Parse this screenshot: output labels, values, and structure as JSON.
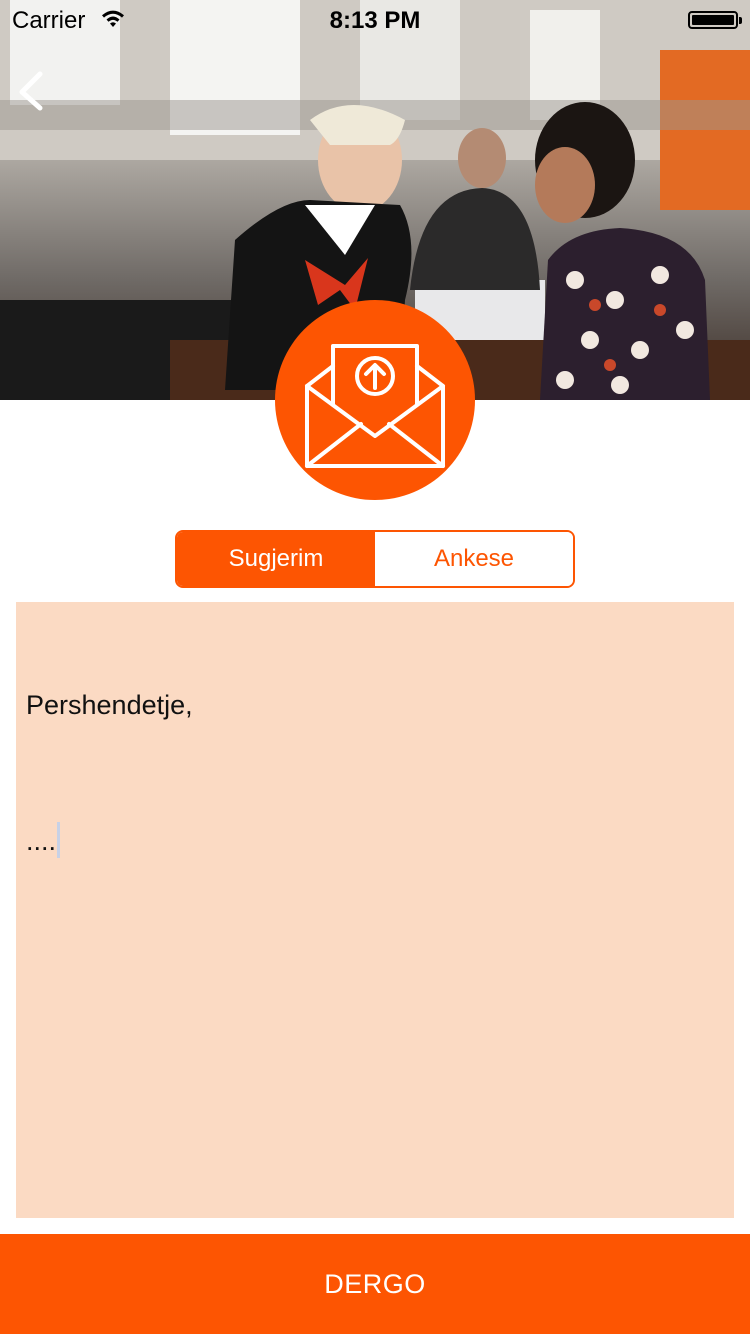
{
  "status_bar": {
    "carrier": "Carrier",
    "time": "8:13 PM",
    "wifi_icon": "wifi-icon",
    "battery_icon": "battery-icon"
  },
  "header": {
    "back_icon": "chevron-left-icon",
    "hero_image": "photo of a bank teller assisting a customer at a service counter"
  },
  "badge": {
    "icon": "envelope-upload-icon"
  },
  "segmented_control": {
    "options": [
      {
        "label": "Sugjerim",
        "selected": true
      },
      {
        "label": "Ankese",
        "selected": false
      }
    ]
  },
  "message": {
    "line1": "Pershendetje,",
    "line2": "...."
  },
  "submit": {
    "label": "DERGO"
  },
  "colors": {
    "accent": "#fd5502",
    "text_area_bg": "#fbdac3"
  }
}
